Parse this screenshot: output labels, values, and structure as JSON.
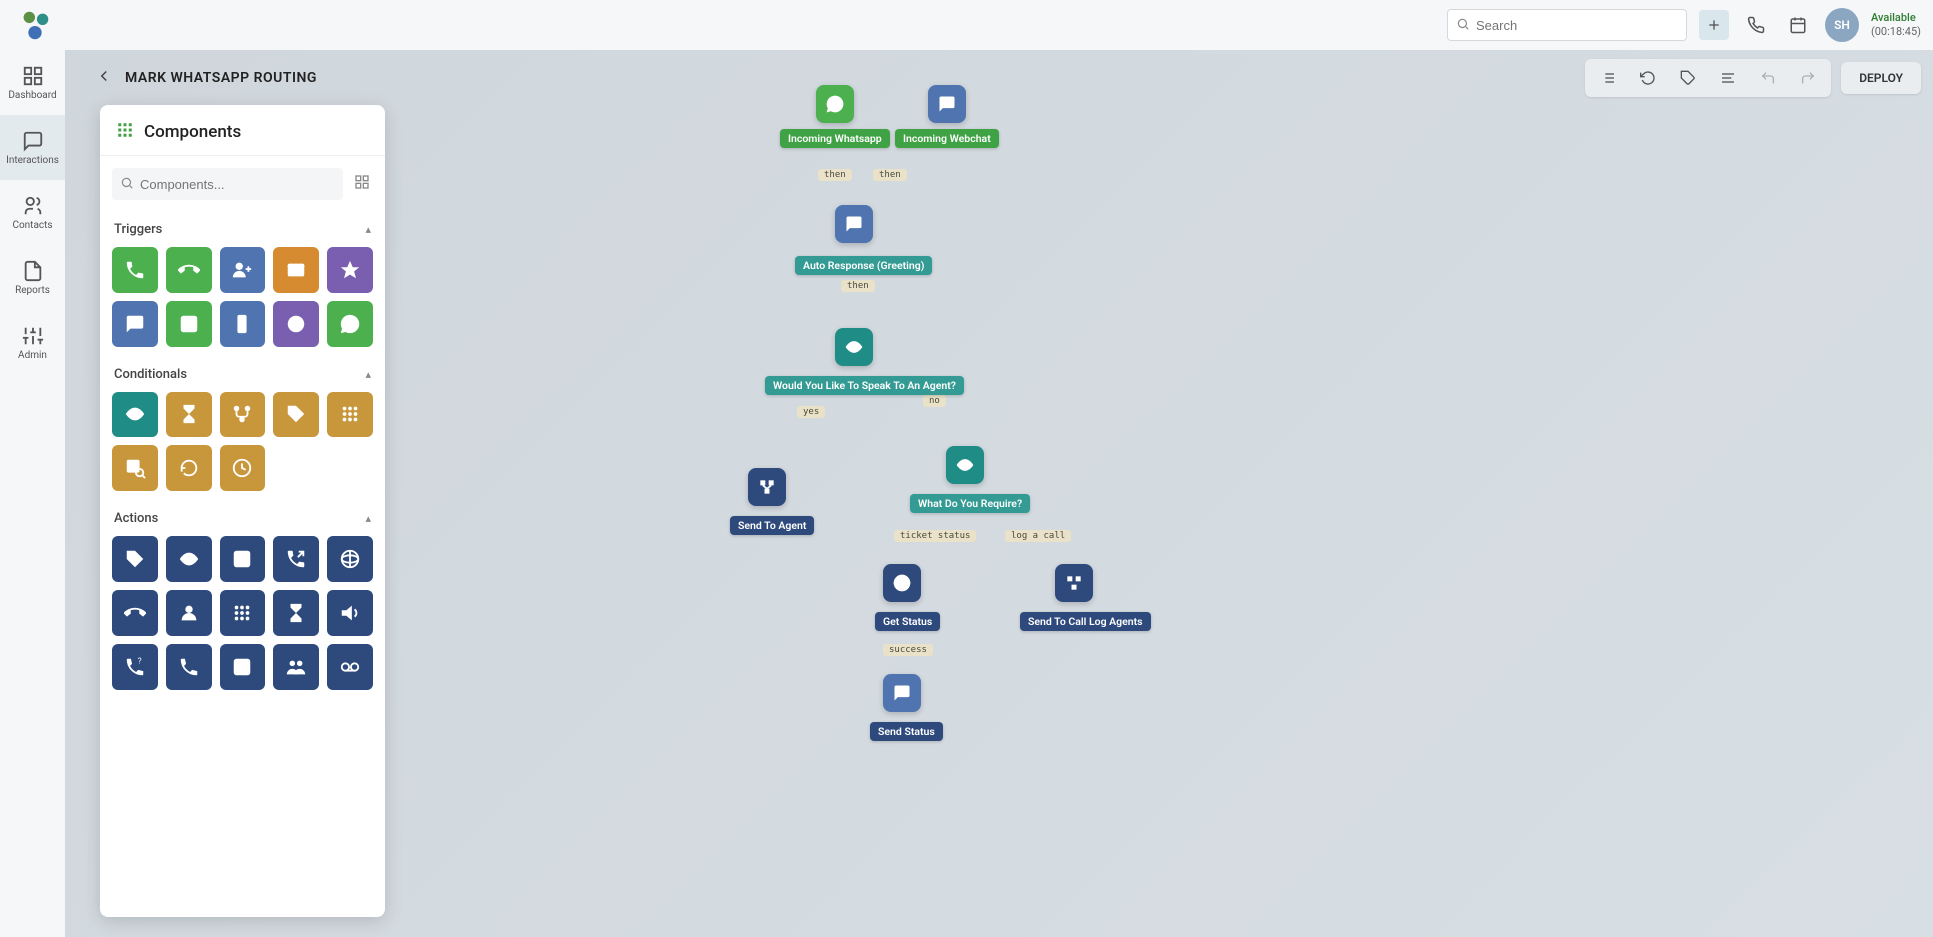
{
  "header": {
    "search_placeholder": "Search",
    "avatar_initials": "SH",
    "availability_status": "Available",
    "availability_timer": "(00:18:45)"
  },
  "rail": {
    "items": [
      {
        "id": "dashboard",
        "label": "Dashboard"
      },
      {
        "id": "interactions",
        "label": "Interactions"
      },
      {
        "id": "contacts",
        "label": "Contacts"
      },
      {
        "id": "reports",
        "label": "Reports"
      },
      {
        "id": "admin",
        "label": "Admin"
      }
    ]
  },
  "page": {
    "title": "MARK WHATSAPP ROUTING",
    "deploy_label": "DEPLOY"
  },
  "components_panel": {
    "title": "Components",
    "search_placeholder": "Components...",
    "sections": [
      {
        "id": "triggers",
        "label": "Triggers"
      },
      {
        "id": "conditionals",
        "label": "Conditionals"
      },
      {
        "id": "actions",
        "label": "Actions"
      }
    ]
  },
  "flow": {
    "nodes": {
      "incoming_whatsapp": {
        "label": "Incoming Whatsapp"
      },
      "incoming_webchat": {
        "label": "Incoming Webchat"
      },
      "auto_response": {
        "label": "Auto Response (Greeting)"
      },
      "ask_agent": {
        "label": "Would You Like To Speak To An Agent?"
      },
      "send_to_agent": {
        "label": "Send To Agent"
      },
      "what_require": {
        "label": "What Do You Require?"
      },
      "get_status": {
        "label": "Get Status"
      },
      "send_call_log": {
        "label": "Send To Call Log Agents"
      },
      "send_status": {
        "label": "Send Status"
      }
    },
    "edges": {
      "wa_then": "then",
      "wc_then": "then",
      "greet_then": "then",
      "agent_yes": "yes",
      "agent_no": "no",
      "ticket_status": "ticket status",
      "log_a_call": "log a call",
      "success": "success"
    }
  }
}
